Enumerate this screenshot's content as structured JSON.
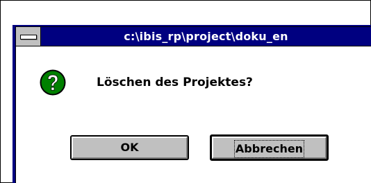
{
  "dialog": {
    "title": "c:\\ibis_rp\\project\\doku_en",
    "message": "Löschen des Projektes?",
    "icon": "question-icon",
    "buttons": {
      "ok_label": "OK",
      "cancel_label": "Abbrechen"
    }
  },
  "colors": {
    "title_bar": "#000080",
    "button_face": "#c0c0c0",
    "icon_green": "#008000"
  }
}
